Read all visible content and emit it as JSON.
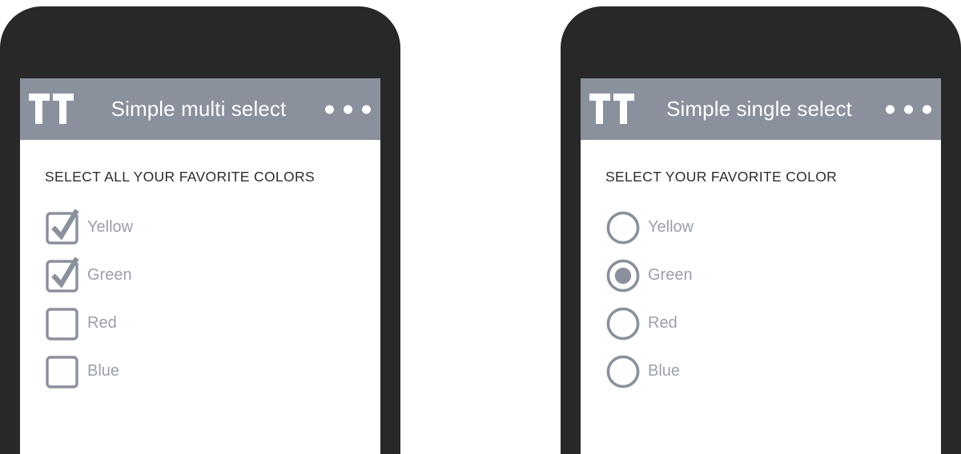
{
  "theme": {
    "frame_color": "#282829",
    "appbar_color": "#8b909d",
    "screen_color": "#ffffff",
    "title_color": "#ffffff",
    "section_title_color": "#2d2d2d",
    "control_color": "#8b909d",
    "label_color": "#9aa0aa",
    "page_background": "#ffffff"
  },
  "phones": [
    {
      "id": "multi-select",
      "appbar": {
        "logo_name": "app-logo-icon",
        "title": "Simple multi select",
        "overflow_menu_name": "overflow-menu-icon",
        "dots": 3
      },
      "section_title": "SELECT ALL YOUR FAVORITE COLORS",
      "control_type": "checkbox",
      "options": [
        {
          "label": "Yellow",
          "checked": true
        },
        {
          "label": "Green",
          "checked": true
        },
        {
          "label": "Red",
          "checked": false
        },
        {
          "label": "Blue",
          "checked": false
        }
      ]
    },
    {
      "id": "single-select",
      "appbar": {
        "logo_name": "app-logo-icon",
        "title": "Simple single select",
        "overflow_menu_name": "overflow-menu-icon",
        "dots": 3
      },
      "section_title": "SELECT YOUR FAVORITE COLOR",
      "control_type": "radio",
      "options": [
        {
          "label": "Yellow",
          "checked": false
        },
        {
          "label": "Green",
          "checked": true
        },
        {
          "label": "Red",
          "checked": false
        },
        {
          "label": "Blue",
          "checked": false
        }
      ]
    }
  ]
}
